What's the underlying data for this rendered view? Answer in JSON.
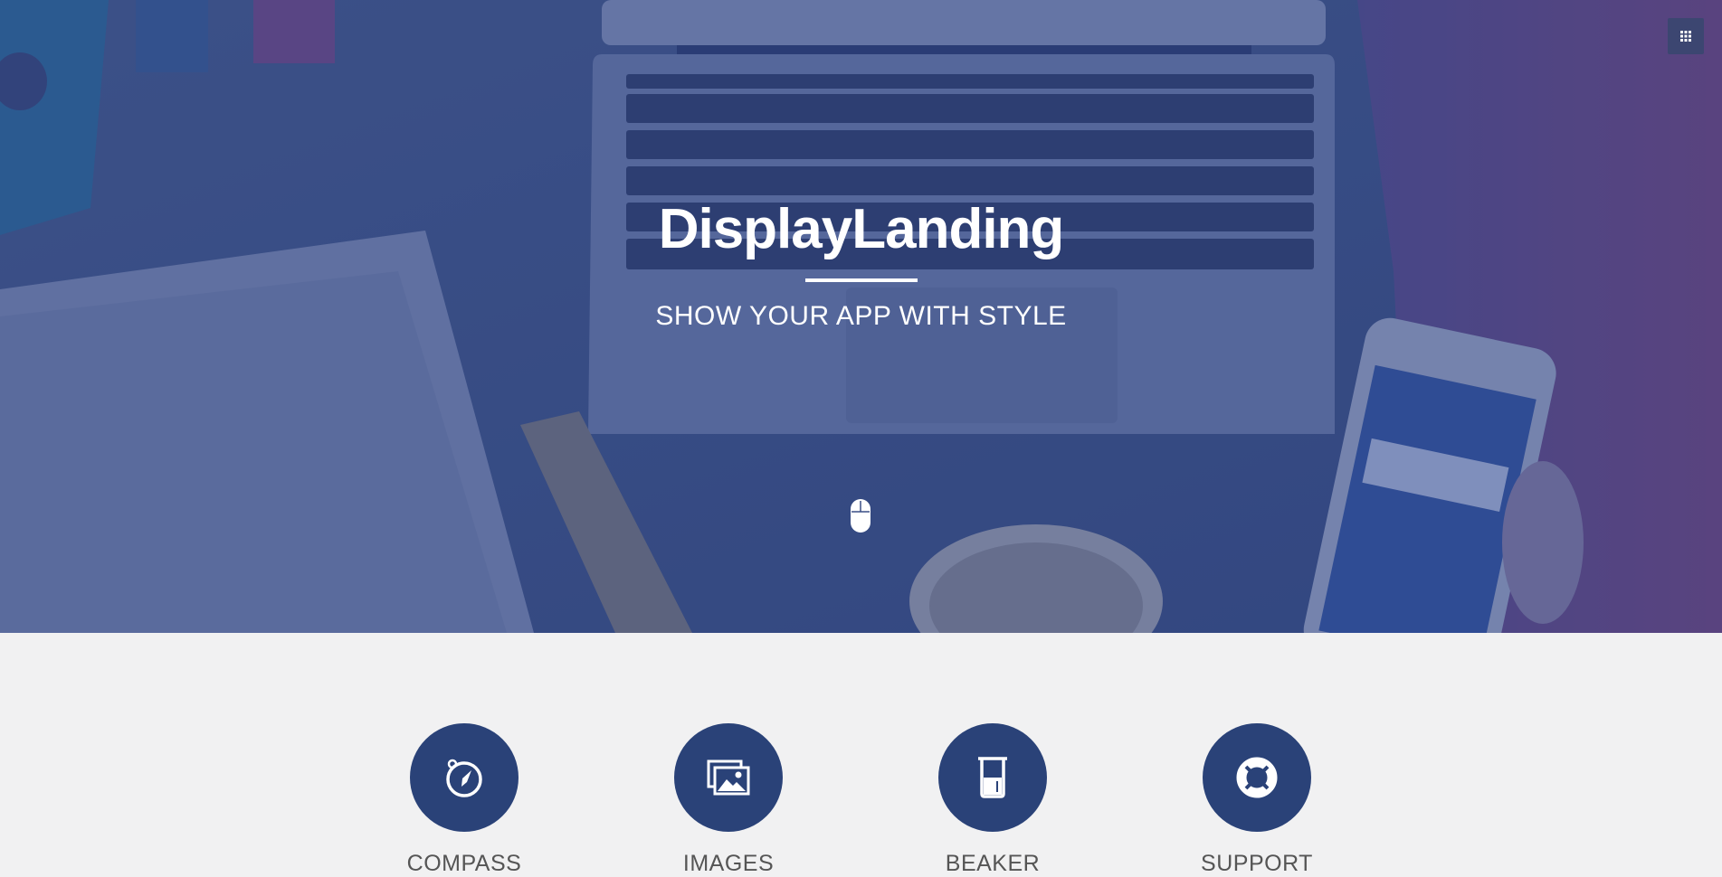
{
  "hero": {
    "title": "DisplayLanding",
    "subtitle": "SHOW YOUR APP WITH STYLE",
    "scroll_icon": "mouse-icon"
  },
  "menu": {
    "icon": "grid-menu-icon"
  },
  "features": [
    {
      "label": "COMPASS",
      "icon": "compass-icon"
    },
    {
      "label": "IMAGES",
      "icon": "images-icon"
    },
    {
      "label": "BEAKER",
      "icon": "beaker-icon"
    },
    {
      "label": "SUPPORT",
      "icon": "life-ring-icon"
    }
  ],
  "colors": {
    "brand_navy": "#2a4278",
    "overlay_blue": "#3a4f86",
    "section_background": "#f1f1f2",
    "label_gray": "#555555"
  }
}
